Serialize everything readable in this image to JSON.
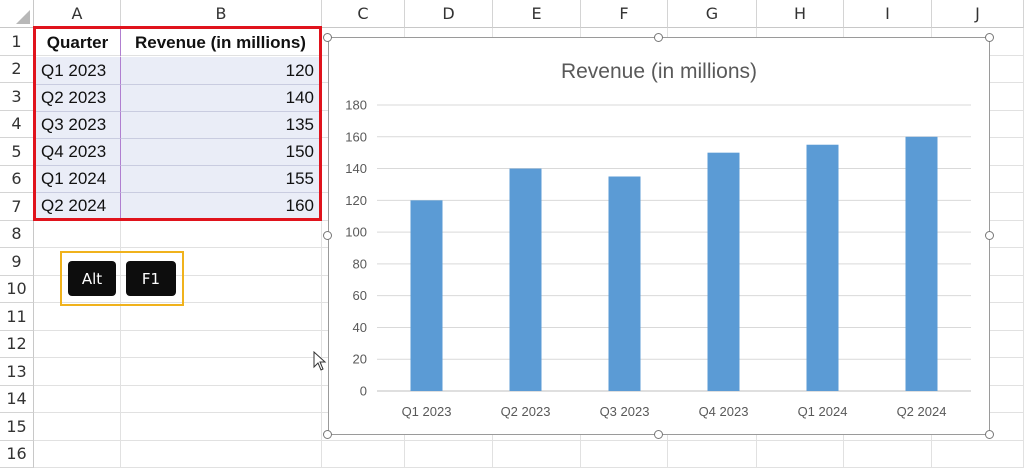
{
  "columns": [
    "A",
    "B",
    "C",
    "D",
    "E",
    "F",
    "G",
    "H",
    "I",
    "J"
  ],
  "rows": [
    "1",
    "2",
    "3",
    "4",
    "5",
    "6",
    "7",
    "8",
    "9",
    "10",
    "11",
    "12",
    "13",
    "14",
    "15",
    "16"
  ],
  "table": {
    "headers": [
      "Quarter",
      "Revenue (in millions)"
    ],
    "quarters": [
      "Q1 2023",
      "Q2 2023",
      "Q3 2023",
      "Q4 2023",
      "Q1 2024",
      "Q2 2024"
    ],
    "revenues": [
      "120",
      "140",
      "135",
      "150",
      "155",
      "160"
    ]
  },
  "keys": {
    "alt": "Alt",
    "f1": "F1"
  },
  "chart_data": {
    "type": "bar",
    "title": "Revenue (in millions)",
    "categories": [
      "Q1 2023",
      "Q2 2023",
      "Q3 2023",
      "Q4 2023",
      "Q1 2024",
      "Q2 2024"
    ],
    "values": [
      120,
      140,
      135,
      150,
      155,
      160
    ],
    "ylim": [
      0,
      180
    ],
    "yticks": [
      "0",
      "20",
      "40",
      "60",
      "80",
      "100",
      "120",
      "140",
      "160",
      "180"
    ],
    "grid": true,
    "legend": "none",
    "bar_color": "#5b9bd5"
  },
  "colors": {
    "selection_border": "#e0131c",
    "keys_border": "#f0b21c",
    "selection_fill": "#eaedf7"
  }
}
